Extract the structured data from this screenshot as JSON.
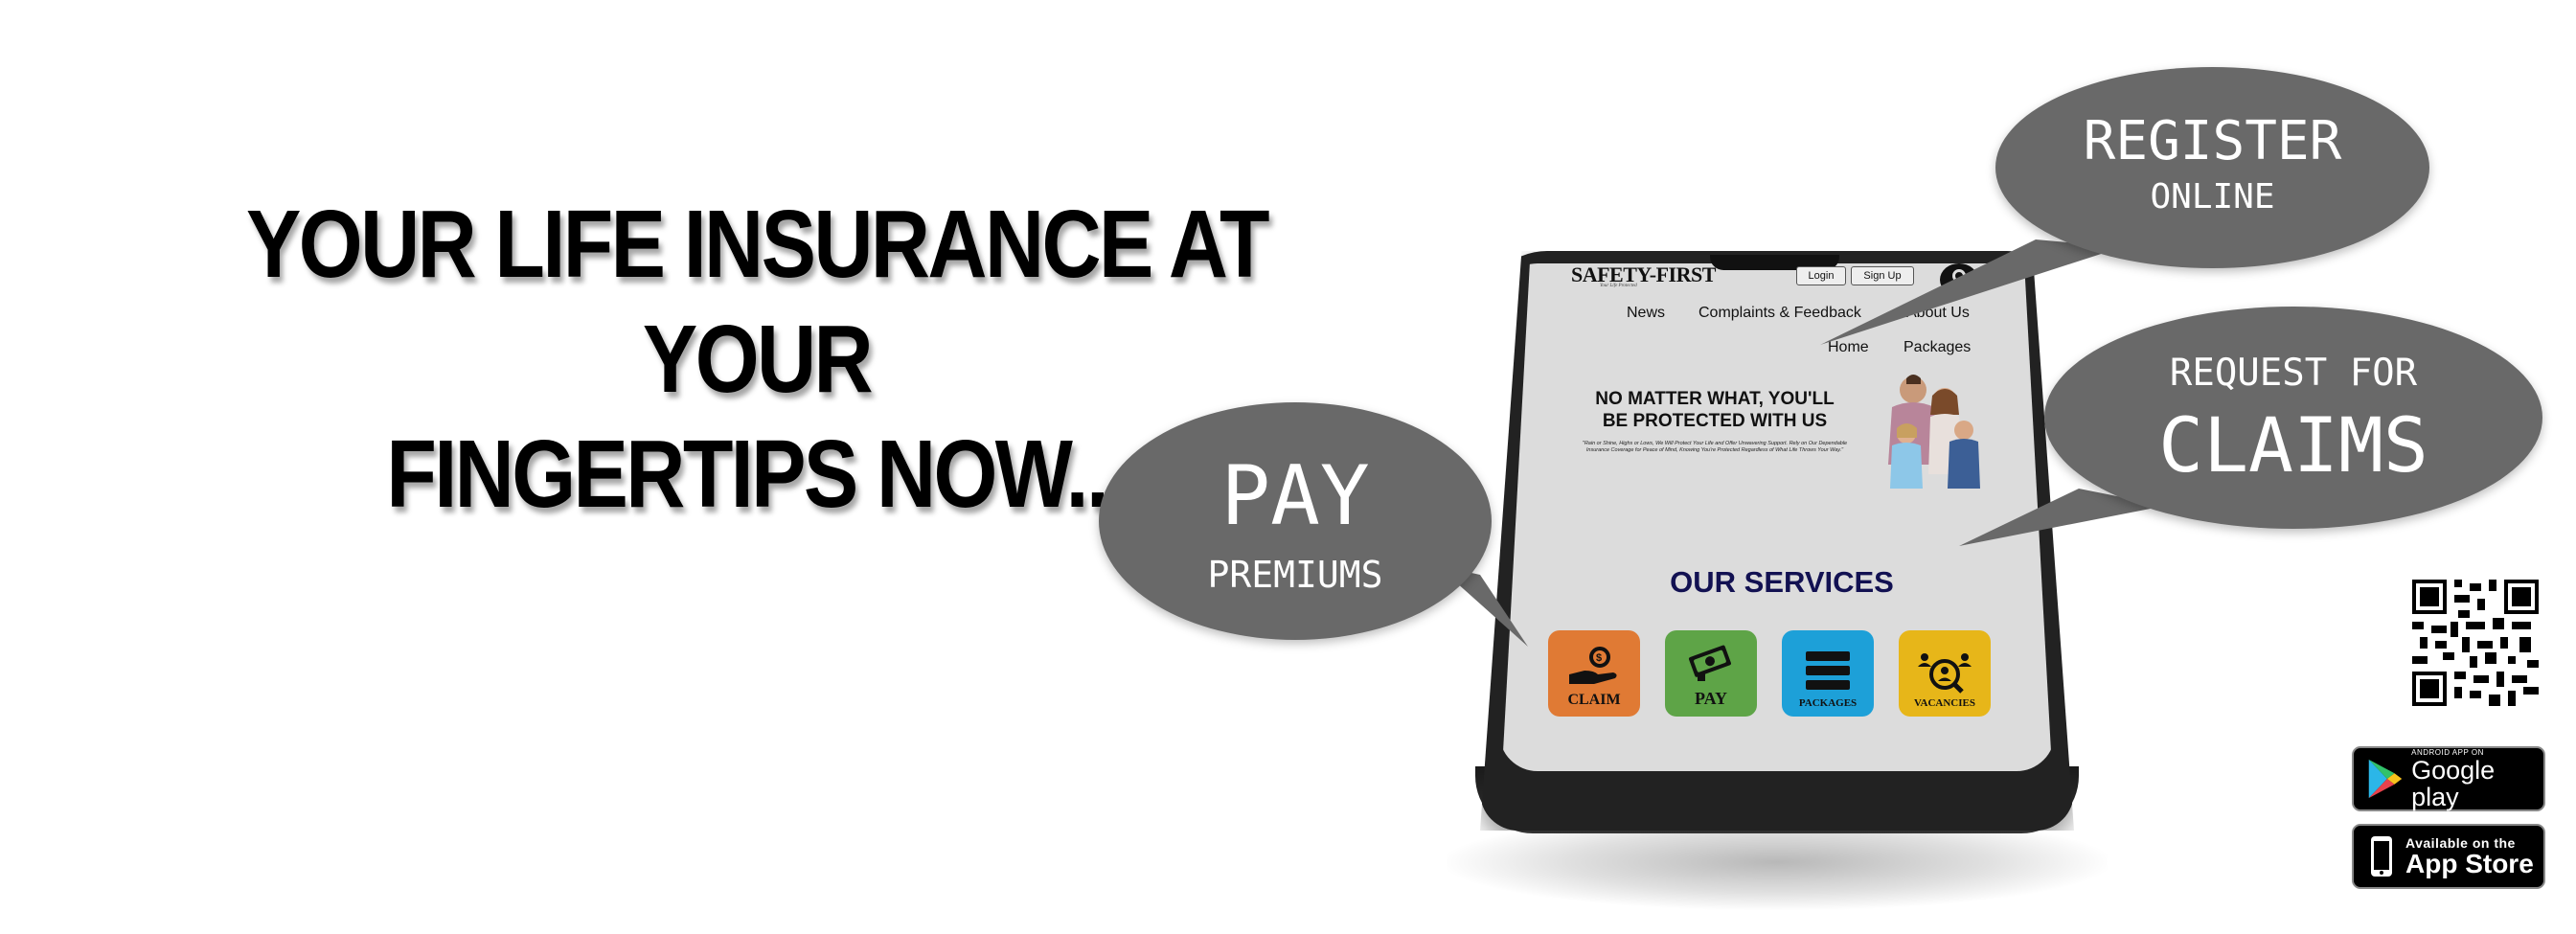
{
  "headline": {
    "line1": "YOUR LIFE INSURANCE AT YOUR",
    "line2": "FINGERTIPS NOW..."
  },
  "phone": {
    "brand": "SAFETY-FIRST",
    "tagline": "Your Life Protected",
    "login": "Login",
    "signup": "Sign Up",
    "nav": [
      "News",
      "Complaints & Feedback",
      "About Us",
      "Home",
      "Packages"
    ],
    "hero_title_1": "NO MATTER WHAT, YOU'LL",
    "hero_title_2": "BE PROTECTED WITH US",
    "hero_subtext": "\"Rain or Shine, Highs or Lows, We Will Protect Your Life and Offer Unwavering Support. Rely on Our Dependable Insurance Coverage for Peace of Mind, Knowing You're Protected Regardless of What Life Throws Your Way.\"",
    "services_title": "OUR SERVICES",
    "services": [
      {
        "label": "CLAIM",
        "color": "#e07a34",
        "icon": "hand-coin-icon"
      },
      {
        "label": "PAY",
        "color": "#5ea447",
        "icon": "money-stack-icon"
      },
      {
        "label": "PACKAGES",
        "color": "#1da0d8",
        "icon": "menu-icon"
      },
      {
        "label": "VACANCIES",
        "color": "#e7b619",
        "icon": "people-search-icon"
      }
    ]
  },
  "bubbles": {
    "register_top": "REGISTER",
    "register_bottom": "ONLINE",
    "claims_top": "REQUEST FOR",
    "claims_bottom": "CLAIMS",
    "pay_top": "PAY",
    "pay_bottom": "PREMIUMS"
  },
  "badges": {
    "google_small": "ANDROID APP ON",
    "google_big": "Google play",
    "apple_small": "Available on the",
    "apple_big": "App Store"
  },
  "colors": {
    "bubble": "#696969",
    "services_title": "#121152"
  }
}
